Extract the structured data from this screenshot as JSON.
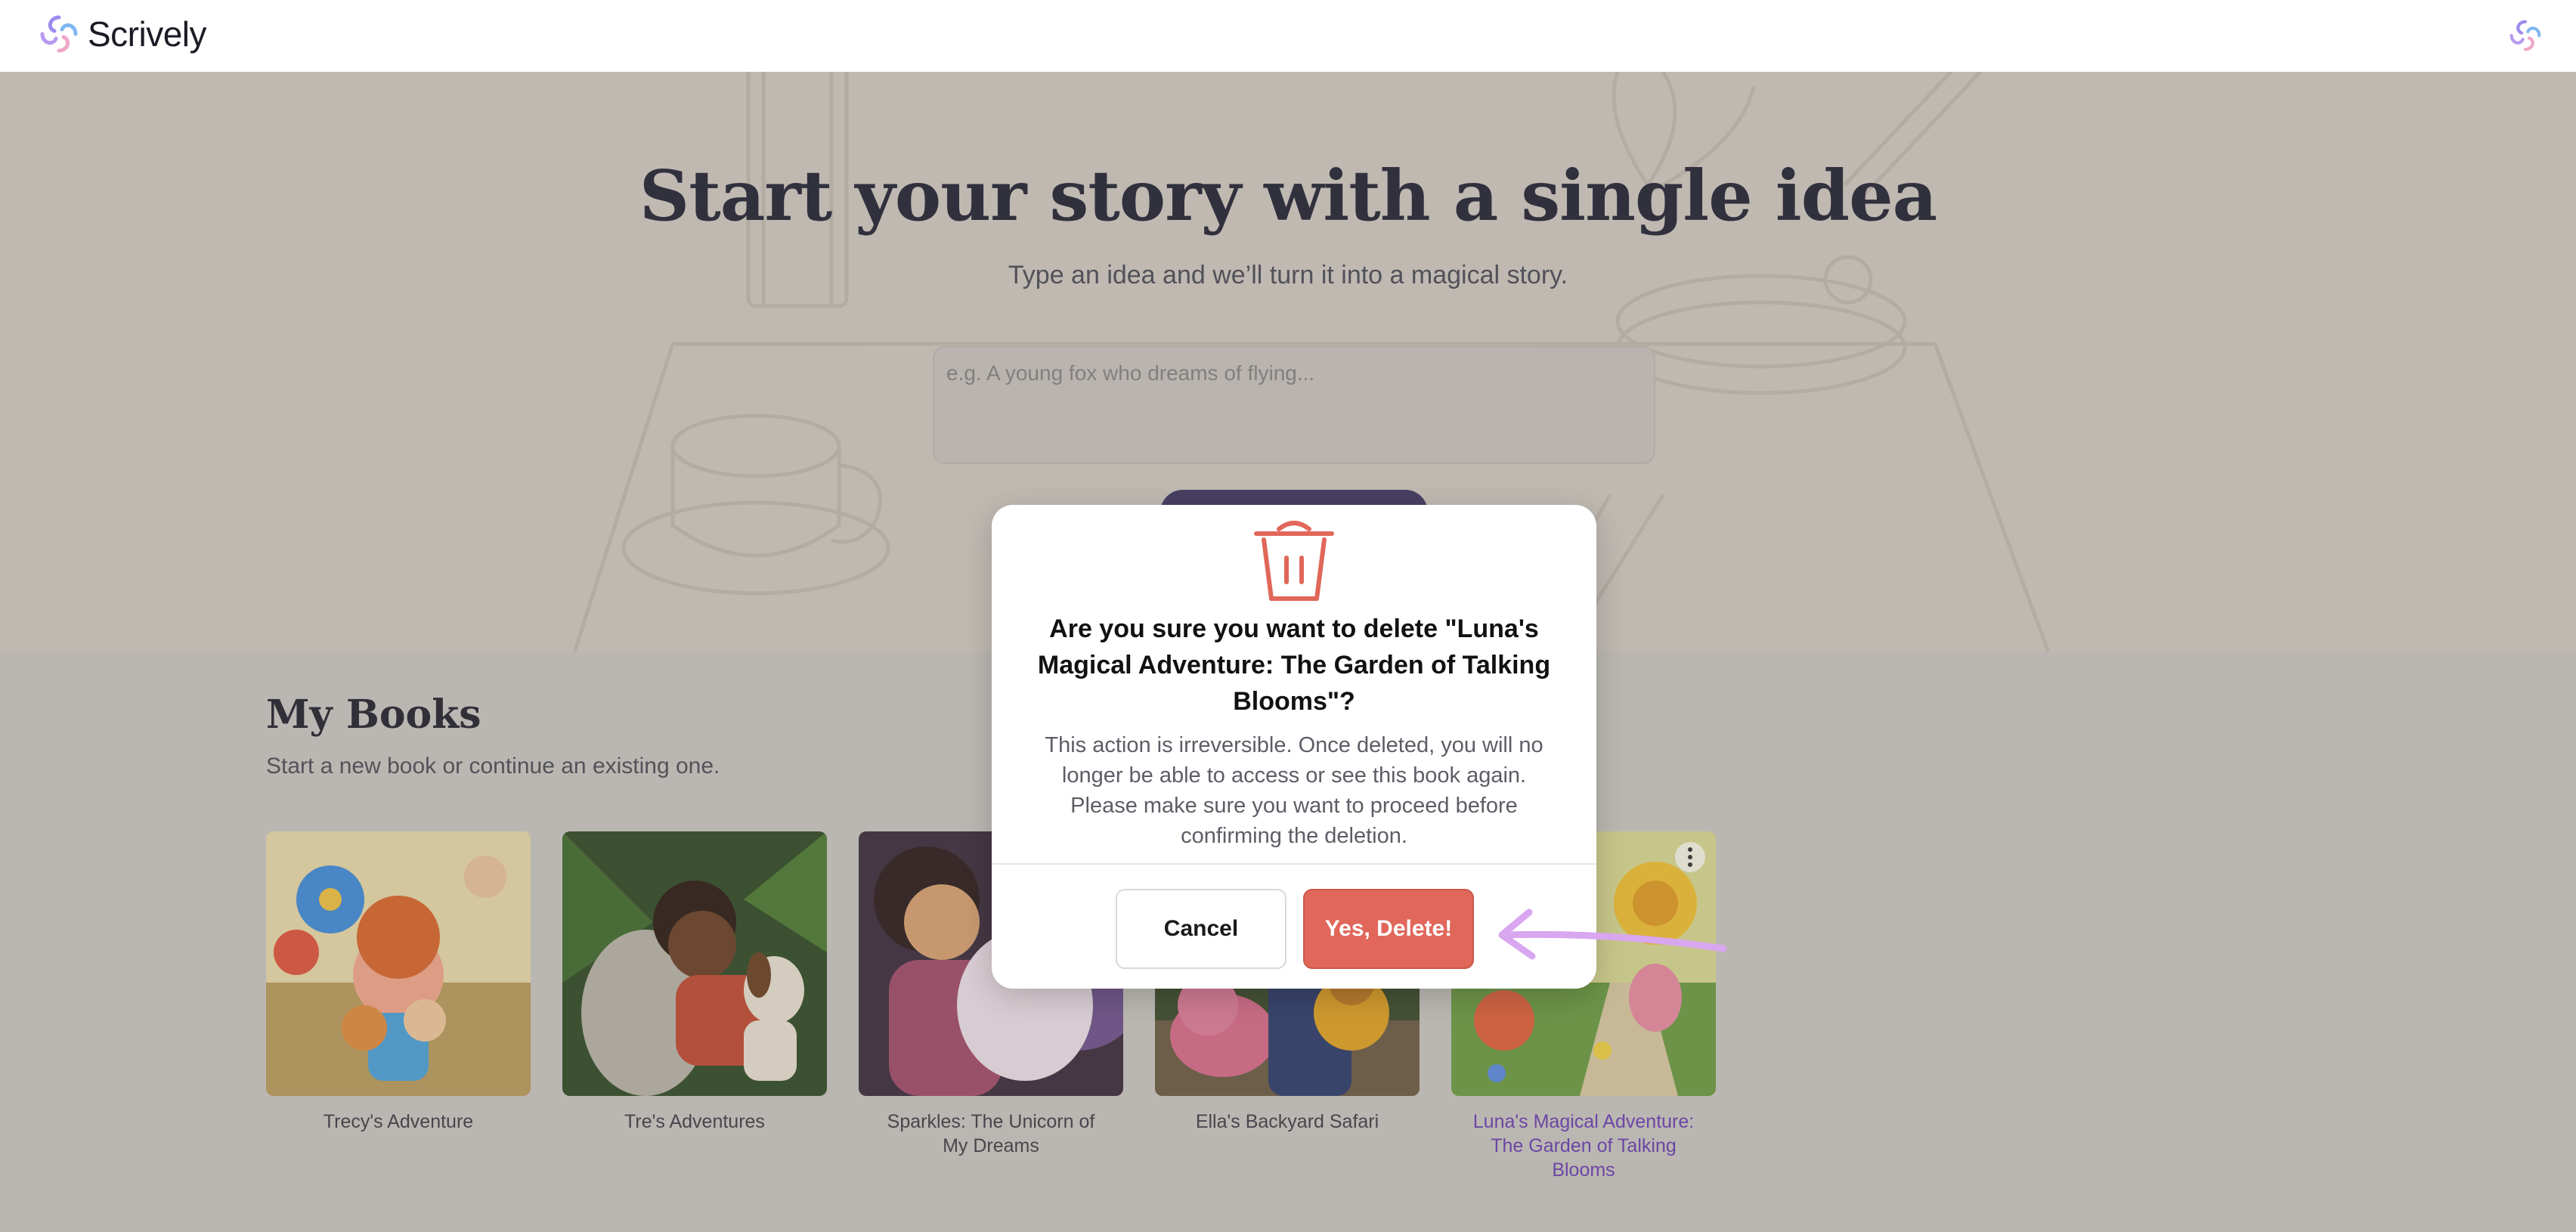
{
  "app": {
    "name": "Scrively"
  },
  "hero": {
    "title": "Start your story with a single idea",
    "subtitle": "Type an idea and we’ll turn it into a magical story.",
    "input_placeholder": "e.g. A young fox who dreams of flying..."
  },
  "books": {
    "title": "My Books",
    "subtitle": "Start a new book or continue an existing one.",
    "items": [
      {
        "title": "Trecy's Adventure"
      },
      {
        "title": "Tre's Adventures"
      },
      {
        "title": "Sparkles: The Unicorn of My Dreams"
      },
      {
        "title": "Ella's Backyard Safari"
      },
      {
        "title": "Luna's Magical Adventure: The Garden of Talking Blooms"
      }
    ]
  },
  "dialog": {
    "icon": "trash-icon",
    "title": "Are you sure you want to delete \"Luna's Magical Adventure: The Garden of Talking Blooms\"?",
    "body": "This action is irreversible. Once deleted, you will no longer be able to access or see this book again. Please make sure you want to proceed before confirming the deletion.",
    "cancel_label": "Cancel",
    "confirm_label": "Yes, Delete!"
  },
  "colors": {
    "accent": "#3d3560",
    "danger": "#e0675a",
    "selected_title": "#6a3cb0",
    "annotation": "#d9a6f0"
  }
}
